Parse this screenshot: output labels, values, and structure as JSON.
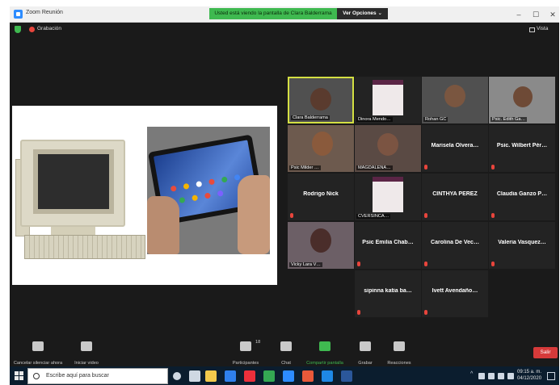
{
  "window": {
    "title": "Zoom Reunión",
    "share_banner": "Usted está viendo la pantalla de Clara Balderrama",
    "view_options": "Ver Opciones ⌄",
    "recording_label": "Grabación",
    "view_label": "Vista",
    "colors": {
      "banner": "#3fb950",
      "recording": "#e8453c",
      "leave": "#d63a3a",
      "active_speaker": "#d4e043"
    }
  },
  "gallery": {
    "tiles": [
      {
        "label": "Clara Balderrama",
        "kind": "video"
      },
      {
        "label": "Dinora Mendo…",
        "kind": "slide"
      },
      {
        "label": "Rohan GC",
        "kind": "video"
      },
      {
        "label": "Psic. Edith Ga…",
        "kind": "video"
      },
      {
        "label": "Psic Milder …",
        "kind": "video"
      },
      {
        "label": "MAGDALENA…",
        "kind": "video"
      },
      {
        "name": "Marisela Olvera…",
        "kind": "name"
      },
      {
        "name": "Psic. Wilbert Pér…",
        "kind": "name"
      },
      {
        "name": "Rodrigo Nick",
        "kind": "name"
      },
      {
        "label": "CVERSINCA…",
        "kind": "slide"
      },
      {
        "name": "CINTHYA PEREZ",
        "kind": "name"
      },
      {
        "name": "Claudia Ganzo P…",
        "kind": "name"
      },
      {
        "label": "Vicky Lara V…",
        "kind": "video"
      },
      {
        "name": "Psic Emilia Chab…",
        "kind": "name"
      },
      {
        "name": "Carolina De Vec…",
        "kind": "name"
      },
      {
        "name": "Valeria Vasquez…",
        "kind": "name"
      },
      {
        "name": "sipinna katia ba…",
        "kind": "name"
      },
      {
        "name": "Ivett Avendaño…",
        "kind": "name"
      }
    ]
  },
  "toolbar": {
    "mute": "Cancelar silenciar ahora",
    "video": "Iniciar video",
    "participants": "Participantes",
    "participants_count": "18",
    "chat": "Chat",
    "share": "Compartir pantalla",
    "record": "Grabar",
    "reactions": "Reacciones",
    "leave": "Salir"
  },
  "taskbar": {
    "search_placeholder": "Escribe aquí para buscar",
    "time": "09:15 a. m.",
    "date": "04/12/2020",
    "apps": [
      "task-view",
      "file-explorer",
      "mail",
      "opera",
      "chrome",
      "zoom",
      "office",
      "edge",
      "word"
    ],
    "app_colors": [
      "#cfd8e3",
      "#f2c94c",
      "#2f80ed",
      "#eb2f3b",
      "#34a853",
      "#2d8cff",
      "#e8593a",
      "#1e88e5",
      "#2b579a"
    ]
  }
}
